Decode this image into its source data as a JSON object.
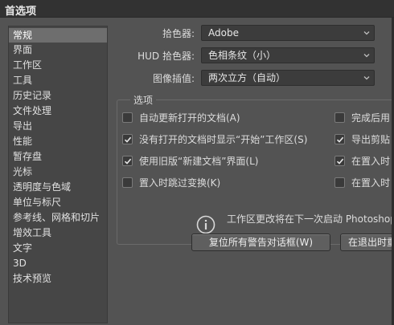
{
  "window": {
    "title": "首选项"
  },
  "nav": {
    "items": [
      {
        "label": "常规",
        "active": true
      },
      {
        "label": "界面"
      },
      {
        "label": "工作区"
      },
      {
        "label": "工具"
      },
      {
        "label": "历史记录"
      },
      {
        "label": "文件处理"
      },
      {
        "label": "导出"
      },
      {
        "label": "性能"
      },
      {
        "label": "暂存盘"
      },
      {
        "label": "光标"
      },
      {
        "label": "透明度与色域"
      },
      {
        "label": "单位与标尺"
      },
      {
        "label": "参考线、网格和切片"
      },
      {
        "label": "增效工具"
      },
      {
        "label": "文字"
      },
      {
        "label": "3D"
      },
      {
        "label": "技术预览"
      }
    ]
  },
  "general": {
    "color_picker_label": "拾色器:",
    "color_picker_value": "Adobe",
    "hud_picker_label": "HUD 拾色器:",
    "hud_picker_value": "色相条纹（小）",
    "interpolation_label": "图像插值:",
    "interpolation_value": "两次立方（自动）"
  },
  "options": {
    "title": "选项",
    "left": [
      {
        "label": "自动更新打开的文档(A)",
        "checked": false
      },
      {
        "label": "没有打开的文档时显示“开始”工作区(S)",
        "checked": true
      },
      {
        "label": "使用旧版“新建文档”界面(L)",
        "checked": true
      },
      {
        "label": "置入时跳过变换(K)",
        "checked": false
      }
    ],
    "right": [
      {
        "label": "完成后用",
        "checked": false
      },
      {
        "label": "导出剪贴",
        "checked": true
      },
      {
        "label": "在置入时",
        "checked": true
      },
      {
        "label": "在置入时",
        "checked": false
      }
    ],
    "info": "工作区更改将在下一次启动 Photoshop"
  },
  "buttons": {
    "reset_warnings": "复位所有警告对话框(W)",
    "on_exit": "在退出时重"
  },
  "colors": {
    "background": "#535353",
    "panel": "#464646",
    "selected": "#6e6e6e",
    "field": "#3c3c3c"
  }
}
